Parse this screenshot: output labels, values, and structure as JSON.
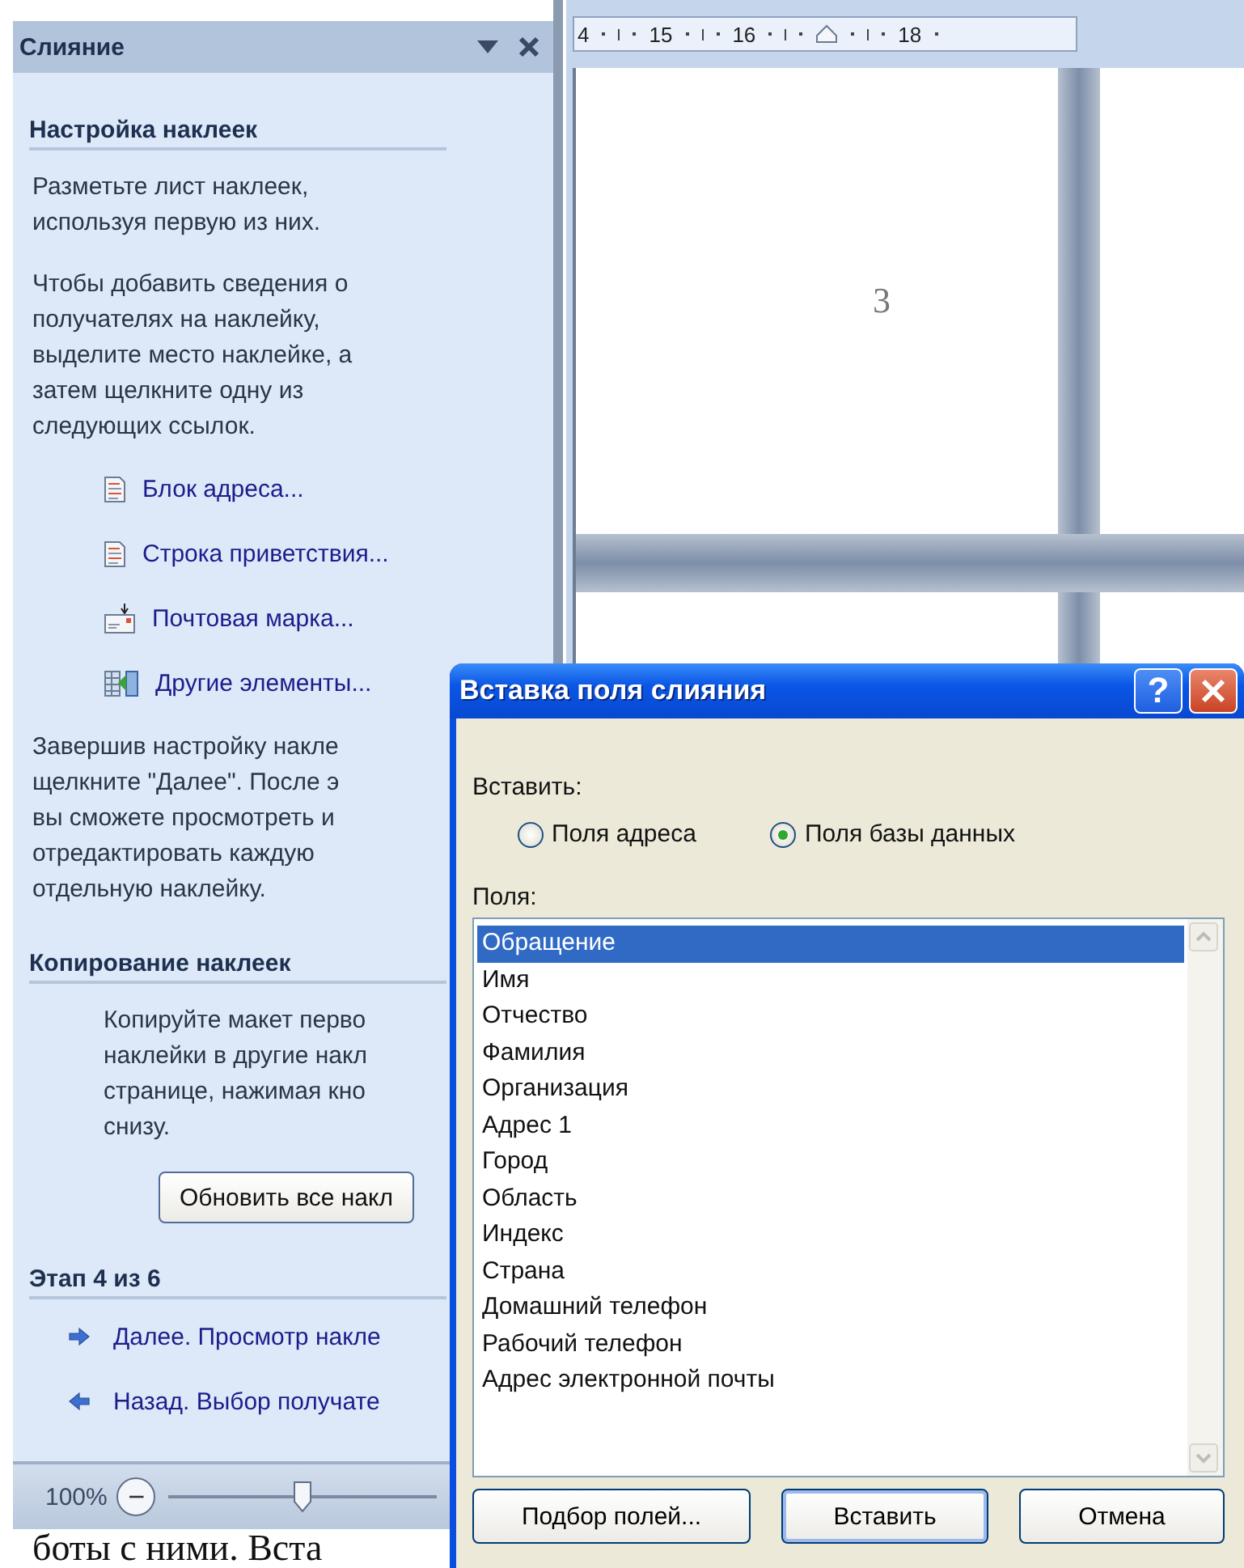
{
  "task_pane": {
    "title": "Слияние",
    "sections": [
      {
        "heading": "Настройка наклеек",
        "items": [
          {
            "kind": "text",
            "lines": [
              "Разметьте лист наклеек,",
              "используя первую из них."
            ]
          },
          {
            "kind": "text",
            "lines": [
              "Чтобы добавить сведения о",
              "получателях на наклейку,",
              "выделите место наклейке, а",
              "затем щелкните одну из",
              "следующих ссылок."
            ]
          },
          {
            "kind": "link",
            "label": "Блок адреса..."
          },
          {
            "kind": "link",
            "label": "Строка приветствия..."
          },
          {
            "kind": "link",
            "label": "Почтовая марка..."
          },
          {
            "kind": "link",
            "label": "Другие элементы..."
          },
          {
            "kind": "text",
            "lines": [
              "Завершив настройку накле",
              "щелкните \"Далее\". После э",
              "вы сможете просмотреть и",
              "отредактировать каждую",
              "отдельную наклейку."
            ]
          }
        ]
      },
      {
        "heading": "Копирование наклеек",
        "items": [
          {
            "kind": "text",
            "lines": [
              "Копируйте макет перво",
              "наклейки в другие накл",
              "странице, нажимая кно",
              "снизу."
            ]
          },
          {
            "kind": "button",
            "label": "Обновить все накл"
          }
        ]
      },
      {
        "heading": "Этап 4 из 6",
        "items": [
          {
            "kind": "nav",
            "label": "Далее. Просмотр накле"
          },
          {
            "kind": "nav",
            "label": "Назад. Выбор получате"
          }
        ]
      }
    ]
  },
  "zoom_bar": {
    "percent": "100%",
    "minus": "−",
    "level": 0.5
  },
  "document": {
    "ruler_labels": [
      "4",
      "15",
      "16",
      "18"
    ],
    "page_number": "3",
    "body_text": "боты с ними. Вста"
  },
  "dialog": {
    "title": "Вставка поля слияния",
    "help": "?",
    "insert_label": "Вставить:",
    "radios": [
      {
        "label": "Поля адреса",
        "selected": false
      },
      {
        "label": "Поля базы данных",
        "selected": true
      }
    ],
    "fields_label": "Поля:",
    "fields": [
      {
        "label": "Обращение",
        "selected": true
      },
      {
        "label": "Имя",
        "selected": false
      },
      {
        "label": "Отчество",
        "selected": false
      },
      {
        "label": "Фамилия",
        "selected": false
      },
      {
        "label": "Организация",
        "selected": false
      },
      {
        "label": "Адрес 1",
        "selected": false
      },
      {
        "label": "Город",
        "selected": false
      },
      {
        "label": "Область",
        "selected": false
      },
      {
        "label": "Индекс",
        "selected": false
      },
      {
        "label": "Страна",
        "selected": false
      },
      {
        "label": "Домашний телефон",
        "selected": false
      },
      {
        "label": "Рабочий телефон",
        "selected": false
      },
      {
        "label": "Адрес электронной почты",
        "selected": false
      }
    ],
    "buttons": [
      {
        "label": "Подбор полей...",
        "default": false
      },
      {
        "label": "Вставить",
        "default": true
      },
      {
        "label": "Отмена",
        "default": false
      }
    ]
  }
}
